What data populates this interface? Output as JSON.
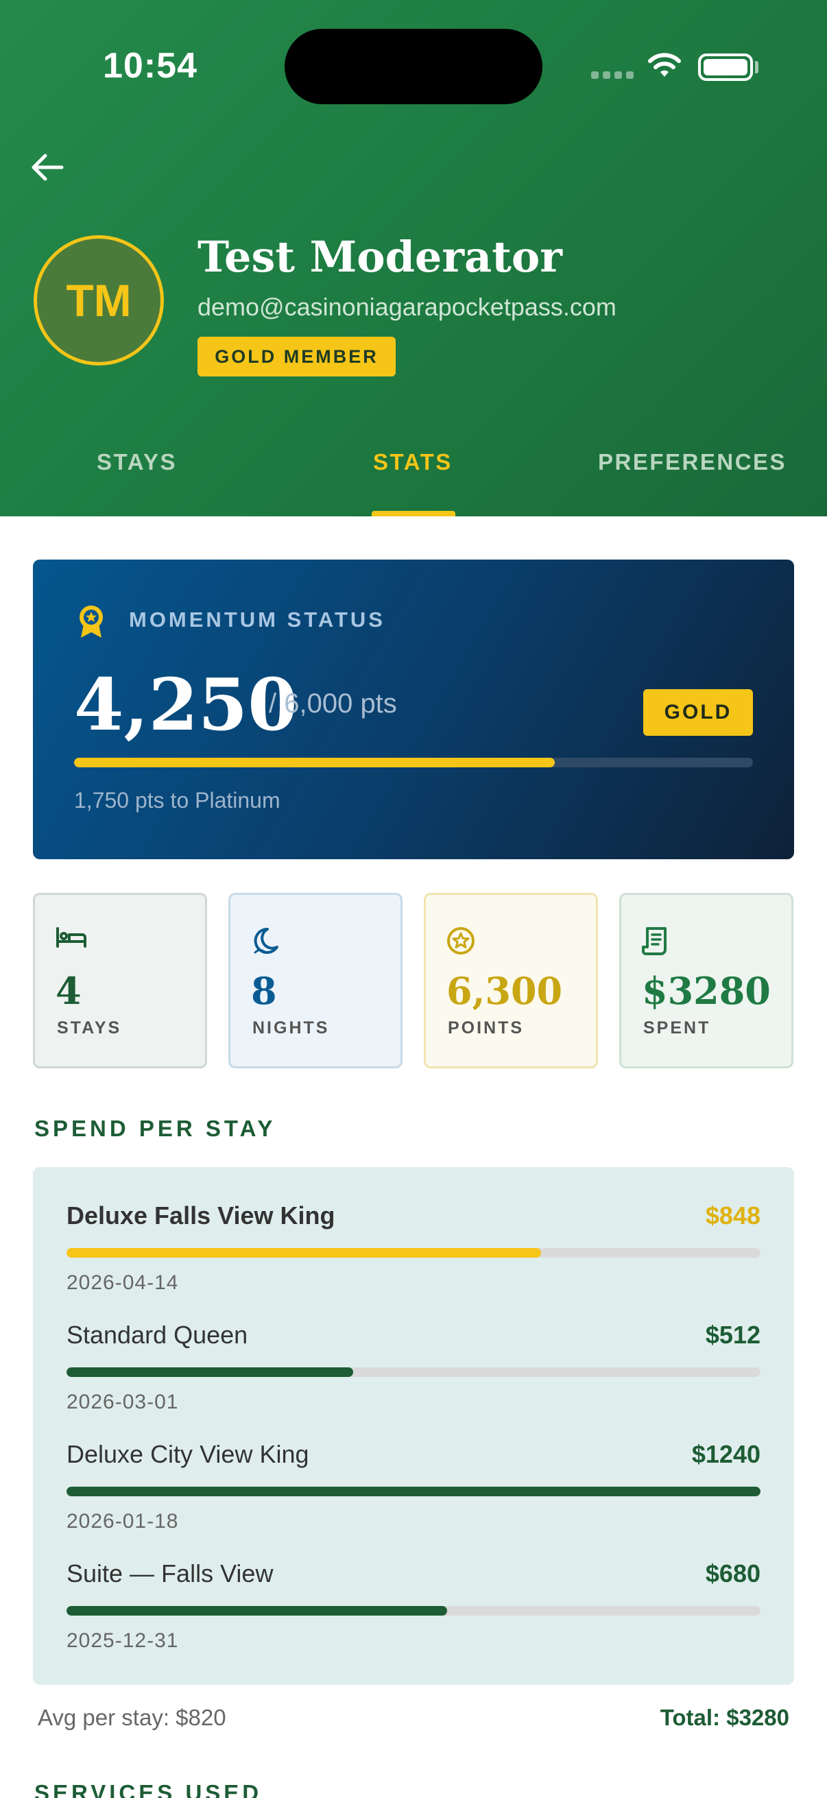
{
  "status_bar": {
    "time": "10:54"
  },
  "header": {
    "back_icon": "arrow-left-icon",
    "avatar_initials": "TM",
    "name": "Test Moderator",
    "email": "demo@casinoniagarapocketpass.com",
    "membership": "GOLD MEMBER"
  },
  "tabs": [
    {
      "label": "STAYS",
      "active": false
    },
    {
      "label": "STATS",
      "active": true
    },
    {
      "label": "PREFERENCES",
      "active": false
    }
  ],
  "momentum": {
    "icon": "award-ribbon-icon",
    "label": "MOMENTUM STATUS",
    "points": "4,250",
    "target": "/ 6,000 pts",
    "tier": "GOLD",
    "progress": 0.708,
    "remaining": "1,750 pts to Platinum"
  },
  "stats": [
    {
      "icon": "bed-icon",
      "value": "4",
      "label": "STAYS",
      "color": "#1d5c35",
      "bg": "#eef2f0",
      "border": "#cfd8d3"
    },
    {
      "icon": "moon-icon",
      "value": "8",
      "label": "NIGHTS",
      "color": "#0b5b93",
      "bg": "#edf4f9",
      "border": "#c6dbea"
    },
    {
      "icon": "star-circle-icon",
      "value": "6,300",
      "label": "POINTS",
      "color": "#c9a613",
      "bg": "#fcfaee",
      "border": "#f1e3b1"
    },
    {
      "icon": "receipt-icon",
      "value": "$3280",
      "label": "SPENT",
      "color": "#1f7a44",
      "bg": "#eef4ef",
      "border": "#cfe0d5"
    }
  ],
  "spend_section": {
    "title": "SPEND PER STAY",
    "items": [
      {
        "name": "Deluxe Falls View King",
        "amount": "$848",
        "date": "2026-04-14",
        "fraction": 0.684,
        "color": "#f5c518",
        "bold_name": true
      },
      {
        "name": "Standard Queen",
        "amount": "$512",
        "date": "2026-03-01",
        "fraction": 0.413,
        "color": "#1d5c35",
        "bold_name": false
      },
      {
        "name": "Deluxe City View King",
        "amount": "$1240",
        "date": "2026-01-18",
        "fraction": 1.0,
        "color": "#1d5c35",
        "bold_name": false
      },
      {
        "name": "Suite — Falls View",
        "amount": "$680",
        "date": "2025-12-31",
        "fraction": 0.548,
        "color": "#1d5c35",
        "bold_name": false
      }
    ],
    "avg": "Avg per stay: $820",
    "total": "Total: $3280"
  },
  "services_section": {
    "title": "SERVICES USED"
  },
  "colors": {
    "brand_green": "#1f7a40",
    "accent_gold": "#f5c518",
    "navy": "#0a3e6b"
  }
}
